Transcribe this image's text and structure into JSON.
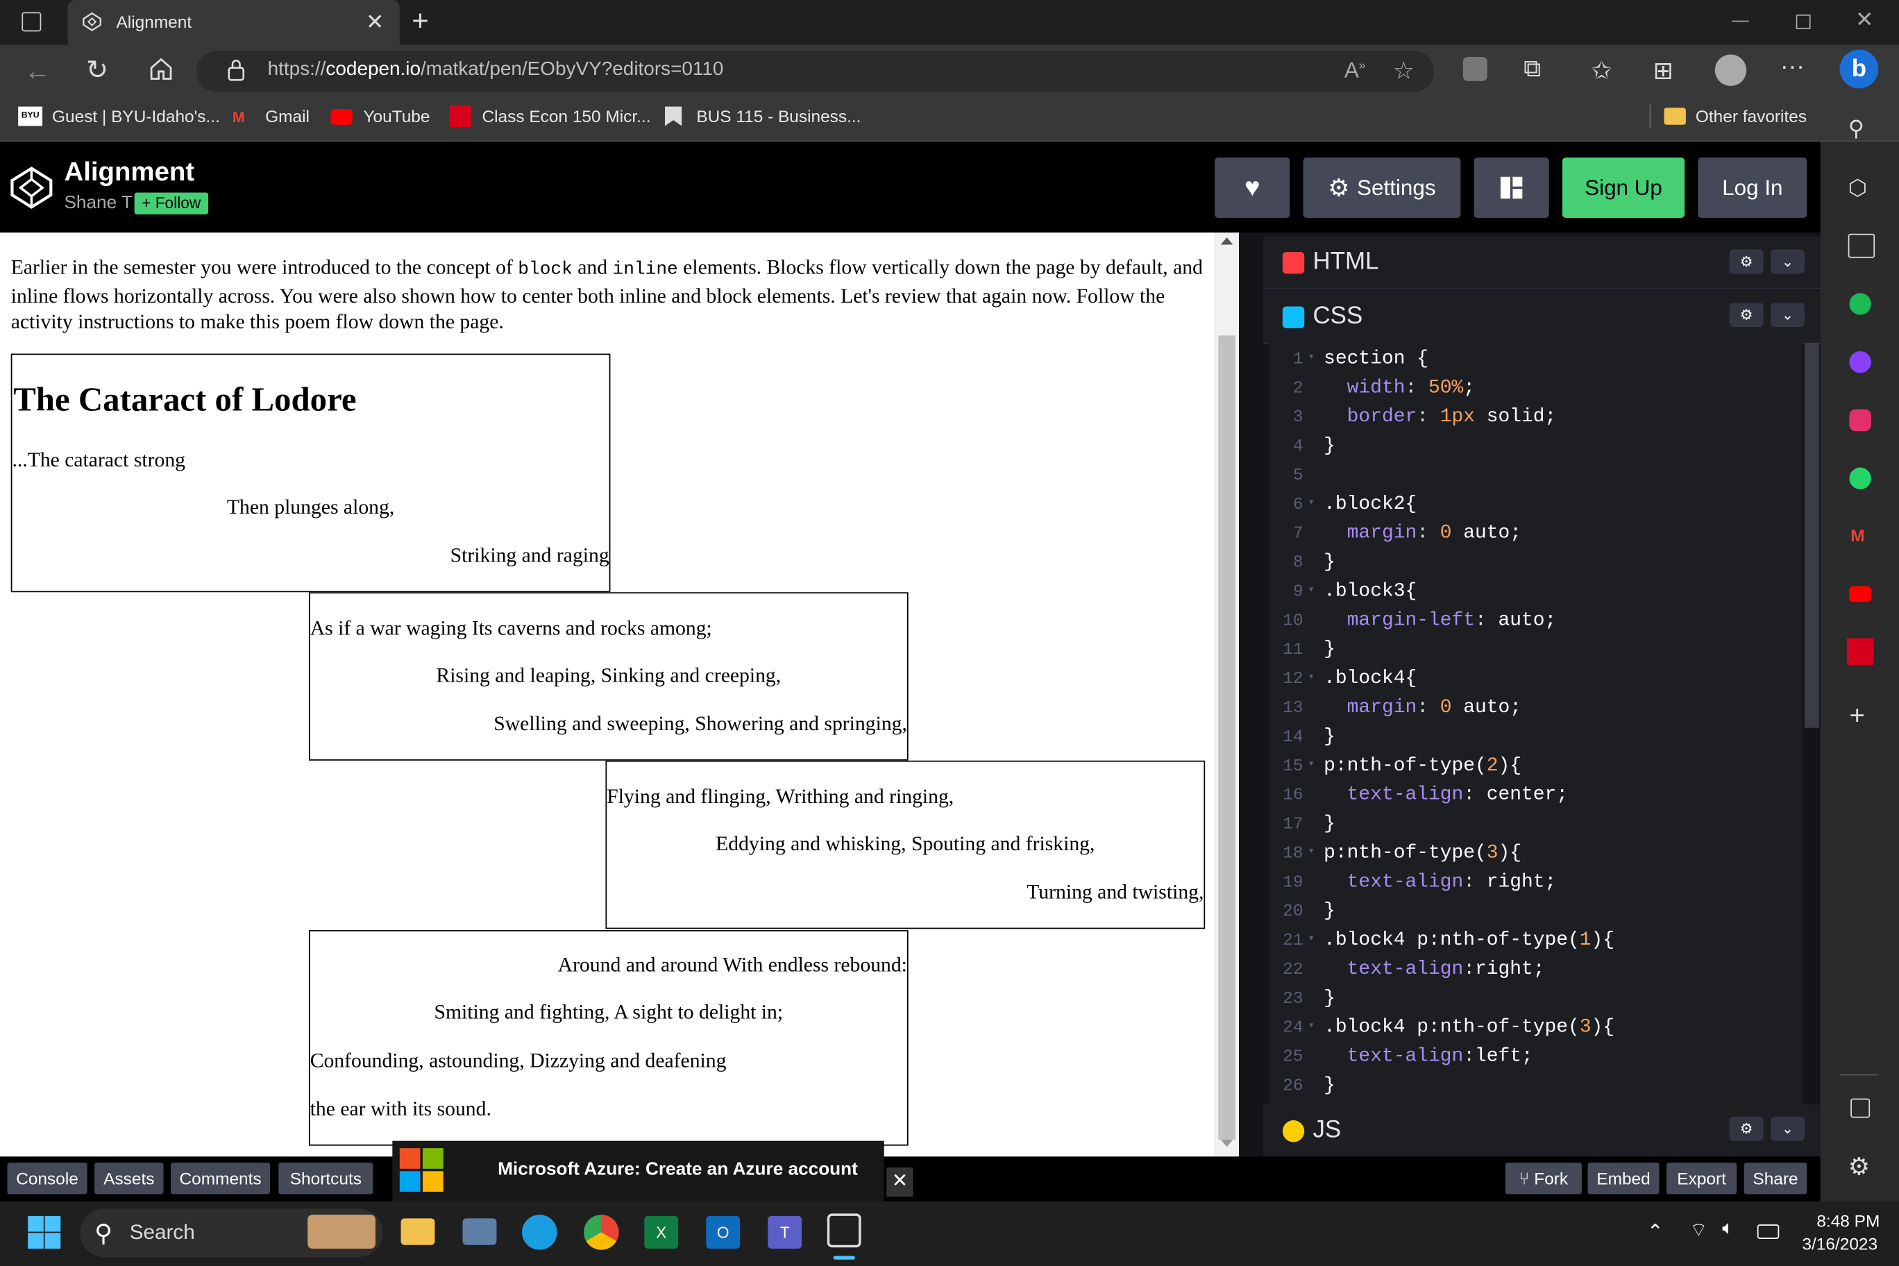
{
  "browser": {
    "tab_title": "Alignment",
    "url_prefix": "https://",
    "url_host": "codepen.io",
    "url_path": "/matkat/pen/EObyVY?editors=0110",
    "favorites": [
      {
        "label": "Guest | BYU-Idaho's..."
      },
      {
        "label": "Gmail"
      },
      {
        "label": "YouTube"
      },
      {
        "label": "Class Econ 150 Micr..."
      },
      {
        "label": "BUS 115 - Business..."
      }
    ],
    "other_favorites": "Other favorites",
    "byu_logo_text": "BYU"
  },
  "codepen": {
    "pen_title": "Alignment",
    "author": "Shane T",
    "follow_label": "+ Follow",
    "settings_label": "Settings",
    "signup_label": "Sign Up",
    "login_label": "Log In"
  },
  "preview": {
    "intro_a": "Earlier in the semester you were introduced to the concept of ",
    "intro_code1": "block",
    "intro_b": " and ",
    "intro_code2": "inline",
    "intro_c": " elements. Blocks flow vertically down the page by default, and inline flows horizontally across. You were also shown how to center both inline and block elements. Let's review that again now. Follow the activity instructions to make this poem flow down the page.",
    "poem_title": "The Cataract of Lodore",
    "block1": [
      "...The cataract strong",
      "Then plunges along,",
      "Striking and raging"
    ],
    "block2": [
      "As if a war waging Its caverns and rocks among;",
      "Rising and leaping, Sinking and creeping,",
      "Swelling and sweeping, Showering and springing,"
    ],
    "block3": [
      "Flying and flinging, Writhing and ringing,",
      "Eddying and whisking, Spouting and frisking,",
      "Turning and twisting,"
    ],
    "block4": [
      "Around and around With endless rebound:",
      "Smiting and fighting, A sight to delight in;",
      "Confounding, astounding, Dizzying and deafening",
      "the ear with its sound."
    ]
  },
  "editor": {
    "html_label": "HTML",
    "css_label": "CSS",
    "js_label": "JS",
    "css_lines": [
      {
        "n": "1",
        "fold": true,
        "t": "section {"
      },
      {
        "n": "2",
        "t": "  width: 50%;"
      },
      {
        "n": "3",
        "t": "  border: 1px solid;"
      },
      {
        "n": "4",
        "t": "}"
      },
      {
        "n": "5",
        "t": ""
      },
      {
        "n": "6",
        "fold": true,
        "t": ".block2{"
      },
      {
        "n": "7",
        "t": "  margin: 0 auto;"
      },
      {
        "n": "8",
        "t": "}"
      },
      {
        "n": "9",
        "fold": true,
        "t": ".block3{"
      },
      {
        "n": "10",
        "t": "  margin-left: auto;"
      },
      {
        "n": "11",
        "t": "}"
      },
      {
        "n": "12",
        "fold": true,
        "t": ".block4{"
      },
      {
        "n": "13",
        "t": "  margin: 0 auto;"
      },
      {
        "n": "14",
        "t": "}"
      },
      {
        "n": "15",
        "fold": true,
        "t": "p:nth-of-type(2){"
      },
      {
        "n": "16",
        "t": "  text-align: center;"
      },
      {
        "n": "17",
        "t": "}"
      },
      {
        "n": "18",
        "fold": true,
        "t": "p:nth-of-type(3){"
      },
      {
        "n": "19",
        "t": "  text-align: right;"
      },
      {
        "n": "20",
        "t": "}"
      },
      {
        "n": "21",
        "fold": true,
        "t": ".block4 p:nth-of-type(1){"
      },
      {
        "n": "22",
        "t": "  text-align:right;"
      },
      {
        "n": "23",
        "t": "}"
      },
      {
        "n": "24",
        "fold": true,
        "t": ".block4 p:nth-of-type(3){"
      },
      {
        "n": "25",
        "t": "  text-align:left;"
      },
      {
        "n": "26",
        "t": "}"
      }
    ]
  },
  "footer": {
    "console": "Console",
    "assets": "Assets",
    "comments": "Comments",
    "shortcuts": "Shortcuts",
    "ad_text": "Microsoft Azure: Create an Azure account",
    "fork": "Fork",
    "embed": "Embed",
    "export": "Export",
    "share": "Share"
  },
  "taskbar": {
    "search": "Search",
    "time": "8:48 PM",
    "date": "3/16/2023"
  },
  "colors": {
    "signup_green": "#47cf73",
    "codepen_button": "#444857",
    "html_icon": "#ff3c41",
    "css_icon": "#0ebeff",
    "js_icon": "#fcd000"
  }
}
